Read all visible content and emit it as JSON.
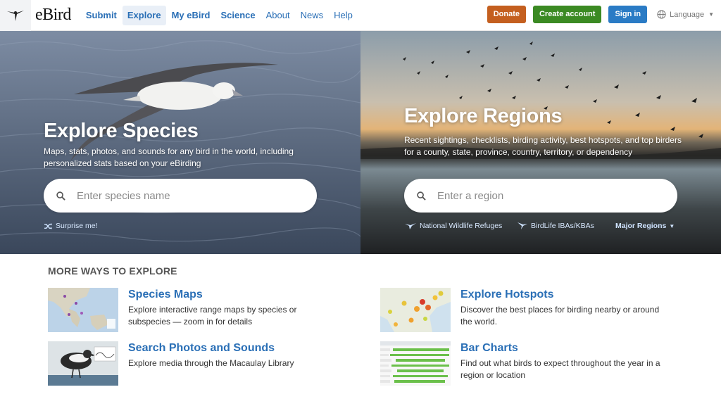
{
  "header": {
    "brand": "eBird",
    "nav": [
      {
        "label": "Submit",
        "bold": true
      },
      {
        "label": "Explore",
        "bold": true,
        "active": true
      },
      {
        "label": "My eBird",
        "bold": true
      },
      {
        "label": "Science",
        "bold": true
      },
      {
        "label": "About"
      },
      {
        "label": "News"
      },
      {
        "label": "Help"
      }
    ],
    "donate_label": "Donate",
    "create_account_label": "Create account",
    "sign_in_label": "Sign in",
    "language_label": "Language"
  },
  "species": {
    "title": "Explore Species",
    "description": "Maps, stats, photos, and sounds for any bird in the world, including personalized stats based on your eBirding",
    "search_placeholder": "Enter species name",
    "surprise_label": "Surprise me!"
  },
  "regions": {
    "title": "Explore Regions",
    "description": "Recent sightings, checklists, birding activity, best hotspots, and top birders for a county, state, province, country, territory, or dependency",
    "search_placeholder": "Enter a region",
    "links": [
      "National Wildlife Refuges",
      "BirdLife IBAs/KBAs"
    ],
    "major_regions_label": "Major Regions"
  },
  "more_ways": {
    "title": "MORE WAYS TO EXPLORE",
    "cards": [
      {
        "title": "Species Maps",
        "description": "Explore interactive range maps by species or subspecies — zoom in for details"
      },
      {
        "title": "Explore Hotspots",
        "description": "Discover the best places for birding nearby or around the world."
      },
      {
        "title": "Search Photos and Sounds",
        "description": "Explore media through the Macaulay Library"
      },
      {
        "title": "Bar Charts",
        "description": "Find out what birds to expect throughout the year in a region or location"
      }
    ]
  },
  "colors": {
    "link_blue": "#2a6fb6",
    "donate": "#c45f1f",
    "create_account": "#3b8a23",
    "sign_in": "#2a7bc5"
  }
}
